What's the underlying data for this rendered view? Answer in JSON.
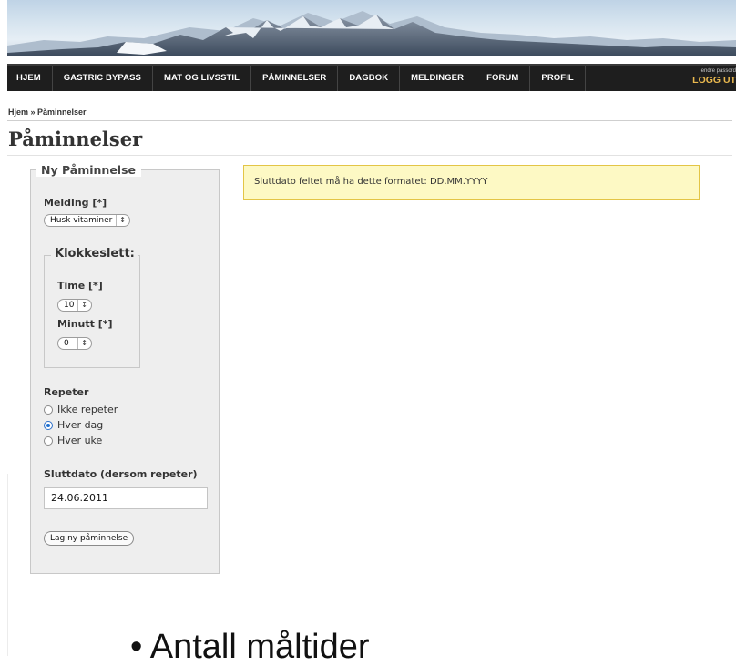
{
  "nav": {
    "items": [
      "HJEM",
      "GASTRIC BYPASS",
      "MAT OG LIVSSTIL",
      "PÅMINNELSER",
      "DAGBOK",
      "MELDINGER",
      "FORUM",
      "PROFIL"
    ],
    "user_text": "endre passord",
    "logout_label": "LOGG UT"
  },
  "breadcrumb": "Hjem » Påminnelser",
  "page_title": "Påminnelser",
  "form": {
    "legend": "Ny Påminnelse",
    "melding_label": "Melding [*]",
    "melding_value": "Husk vitaminer",
    "klokkeslett_legend": "Klokkeslett:",
    "time_label": "Time [*]",
    "time_value": "10",
    "minutt_label": "Minutt [*]",
    "minutt_value": "0",
    "repeter_label": "Repeter",
    "repeat_options": [
      "Ikke repeter",
      "Hver dag",
      "Hver uke"
    ],
    "repeat_selected_index": 1,
    "sluttdato_label": "Sluttdato (dersom repeter)",
    "sluttdato_value": "24.06.2011",
    "submit_label": "Lag ny påminnelse"
  },
  "message": "Sluttdato feltet må ha dette formatet: DD.MM.YYYY",
  "slide_bullet": "• Antall måltider",
  "colors": {
    "nav_bg": "#1e1e1e",
    "logout": "#e9b84e",
    "message_bg": "#fdf9c4",
    "message_border": "#e3c546",
    "panel_bg": "#eeeeee"
  }
}
